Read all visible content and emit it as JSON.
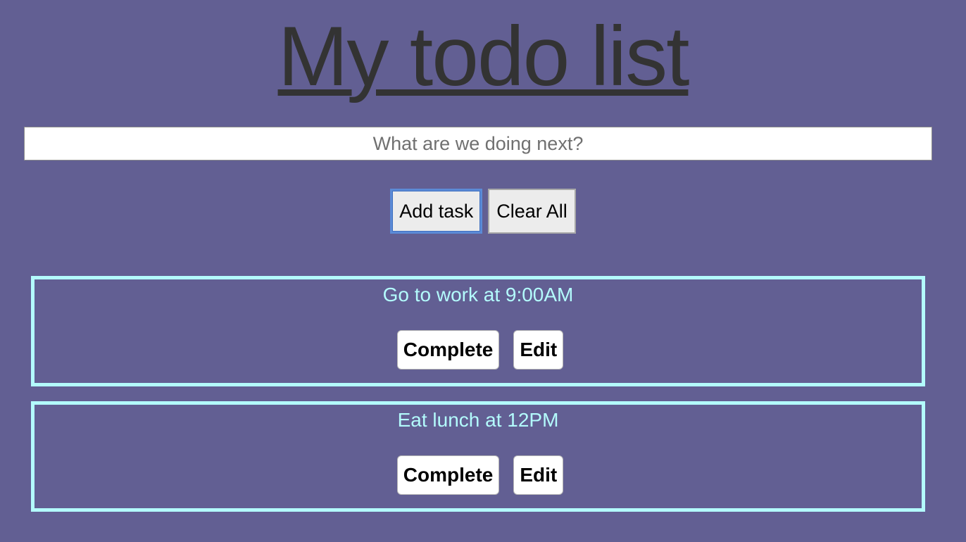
{
  "header": {
    "title": "My todo list"
  },
  "new_task": {
    "placeholder": "What are we doing next?",
    "value": ""
  },
  "controls": {
    "add_label": "Add task",
    "clear_label": "Clear All"
  },
  "tasks": [
    {
      "text": "Go to work at 9:00AM",
      "complete_label": "Complete",
      "edit_label": "Edit"
    },
    {
      "text": "Eat lunch at 12PM",
      "complete_label": "Complete",
      "edit_label": "Edit"
    }
  ],
  "colors": {
    "background": "#625f93",
    "title": "#333333",
    "task_accent": "#b3fbfc"
  }
}
